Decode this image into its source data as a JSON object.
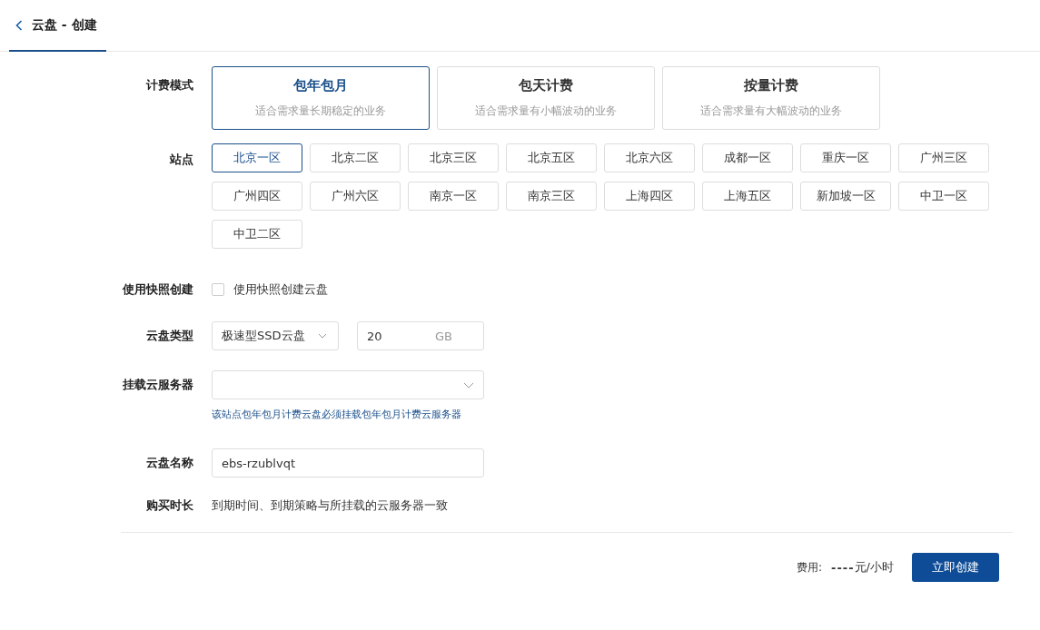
{
  "header": {
    "title": "云盘 - 创建"
  },
  "billing": {
    "label": "计费模式",
    "options": [
      {
        "title": "包年包月",
        "desc": "适合需求量长期稳定的业务",
        "selected": true
      },
      {
        "title": "包天计费",
        "desc": "适合需求量有小幅波动的业务",
        "selected": false
      },
      {
        "title": "按量计费",
        "desc": "适合需求量有大幅波动的业务",
        "selected": false
      }
    ]
  },
  "site": {
    "label": "站点",
    "options": [
      {
        "name": "北京一区",
        "selected": true
      },
      {
        "name": "北京二区",
        "selected": false
      },
      {
        "name": "北京三区",
        "selected": false
      },
      {
        "name": "北京五区",
        "selected": false
      },
      {
        "name": "北京六区",
        "selected": false
      },
      {
        "name": "成都一区",
        "selected": false
      },
      {
        "name": "重庆一区",
        "selected": false
      },
      {
        "name": "广州三区",
        "selected": false
      },
      {
        "name": "广州四区",
        "selected": false
      },
      {
        "name": "广州六区",
        "selected": false
      },
      {
        "name": "南京一区",
        "selected": false
      },
      {
        "name": "南京三区",
        "selected": false
      },
      {
        "name": "上海四区",
        "selected": false
      },
      {
        "name": "上海五区",
        "selected": false
      },
      {
        "name": "新加坡一区",
        "selected": false
      },
      {
        "name": "中卫一区",
        "selected": false
      },
      {
        "name": "中卫二区",
        "selected": false
      }
    ]
  },
  "snapshot": {
    "label": "使用快照创建",
    "checkbox_label": "使用快照创建云盘",
    "checked": false
  },
  "disk_type": {
    "label": "云盘类型",
    "type": "极速型SSD云盘",
    "size": "20",
    "unit": "GB"
  },
  "server": {
    "label": "挂载云服务器",
    "hint": "该站点包年包月计费云盘必须挂载包年包月计费云服务器"
  },
  "name": {
    "label": "云盘名称",
    "value": "ebs-rzublvqt"
  },
  "duration": {
    "label": "购买时长",
    "text": "到期时间、到期策略与所挂载的云服务器一致"
  },
  "footer": {
    "fee_label": "费用:",
    "fee_value": "----",
    "fee_unit": "元/小时",
    "button": "立即创建"
  }
}
